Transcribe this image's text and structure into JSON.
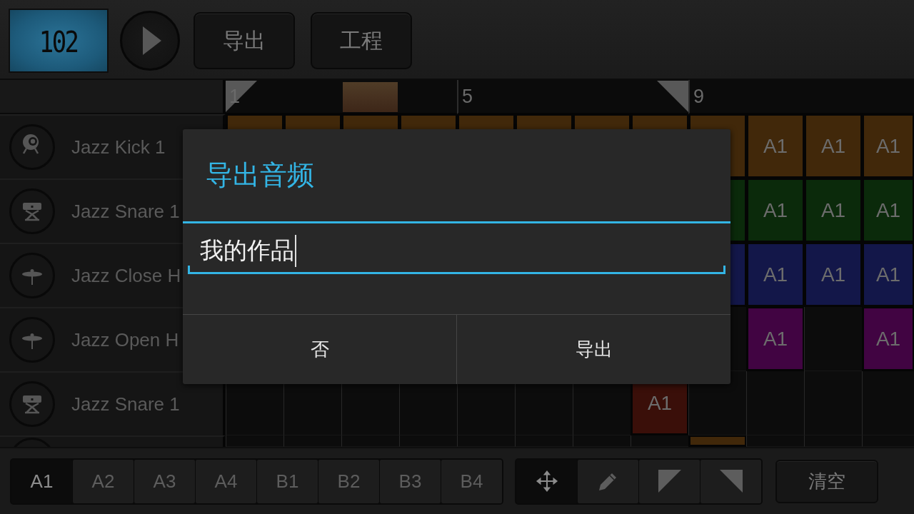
{
  "toolbar": {
    "tempo": "102",
    "buttons": [
      "导出",
      "工程"
    ]
  },
  "ruler": [
    {
      "label": "1",
      "kind": "loop_start",
      "current": false
    },
    {
      "kind": "plain",
      "current": false
    },
    {
      "kind": "plain",
      "current": true
    },
    {
      "kind": "plain",
      "current": false
    },
    {
      "label": "5",
      "kind": "plain",
      "current": false
    },
    {
      "kind": "plain",
      "current": false
    },
    {
      "kind": "plain",
      "current": false
    },
    {
      "kind": "loop_end",
      "current": false
    },
    {
      "label": "9",
      "kind": "plain",
      "current": false
    },
    {
      "kind": "plain",
      "current": false
    },
    {
      "kind": "plain",
      "current": false
    },
    {
      "kind": "plain",
      "current": false
    }
  ],
  "tracks": [
    {
      "name": "Jazz Kick 1",
      "kind": "kick",
      "cells": [
        {
          "color": "#41280a"
        },
        {
          "color": "#41280a"
        },
        {
          "color": "#41280a"
        },
        {
          "color": "#41280a"
        },
        {
          "color": "#41280a"
        },
        {
          "color": "#41280a"
        },
        {
          "color": "#41280a"
        },
        {
          "color": "#41280a"
        },
        {
          "color": "#41280a"
        },
        {
          "color": "#41280a",
          "label": "A1"
        },
        {
          "color": "#41280a",
          "label": "A1"
        },
        {
          "color": "#41280a",
          "label": "A1"
        }
      ]
    },
    {
      "name": "Jazz Snare 1",
      "kind": "snare",
      "cells": [
        {},
        {},
        {},
        {},
        {},
        {},
        {},
        {},
        {
          "color": "#0b2a0b"
        },
        {
          "color": "#0b2a0b",
          "label": "A1"
        },
        {
          "color": "#0b2a0b",
          "label": "A1"
        },
        {
          "color": "#0b2a0b",
          "label": "A1"
        }
      ]
    },
    {
      "name": "Jazz Close H",
      "kind": "cymbal",
      "cells": [
        {},
        {},
        {},
        {},
        {},
        {},
        {},
        {},
        {
          "color": "#131749"
        },
        {
          "color": "#131749",
          "label": "A1"
        },
        {
          "color": "#131749",
          "label": "A1"
        },
        {
          "color": "#131749",
          "label": "A1"
        }
      ]
    },
    {
      "name": "Jazz Open H",
      "kind": "cymbal",
      "cells": [
        {},
        {},
        {},
        {},
        {},
        {},
        {},
        {},
        {},
        {
          "color": "#410442",
          "label": "A1"
        },
        {},
        {
          "color": "#410442",
          "label": "A1"
        }
      ]
    },
    {
      "name": "Jazz Snare 1",
      "kind": "snare",
      "cells": [
        {},
        {},
        {},
        {},
        {},
        {},
        {},
        {
          "color": "#3a0f09",
          "label": "A1"
        },
        {},
        {},
        {},
        {}
      ]
    },
    {
      "cells": [
        {},
        {},
        {},
        {},
        {},
        {},
        {},
        {},
        {
          "color": "#41280a"
        },
        {},
        {},
        {}
      ]
    }
  ],
  "dialog": {
    "title": "导出音频",
    "input": {
      "value": "我的作品"
    },
    "buttons": [
      "否",
      "导出"
    ]
  },
  "patterns": [
    {
      "label": "A1",
      "selected": true
    },
    {
      "label": "A2",
      "selected": false
    },
    {
      "label": "A3",
      "selected": false
    },
    {
      "label": "A4",
      "selected": false
    },
    {
      "label": "B1",
      "selected": false
    },
    {
      "label": "B2",
      "selected": false
    },
    {
      "label": "B3",
      "selected": false
    },
    {
      "label": "B4",
      "selected": false
    }
  ],
  "tools": [
    {
      "kind": "move",
      "selected": true
    },
    {
      "kind": "pencil",
      "selected": false
    },
    {
      "kind": "loop_start",
      "selected": false
    },
    {
      "kind": "loop_end",
      "selected": false
    }
  ],
  "clear_button": "清空"
}
